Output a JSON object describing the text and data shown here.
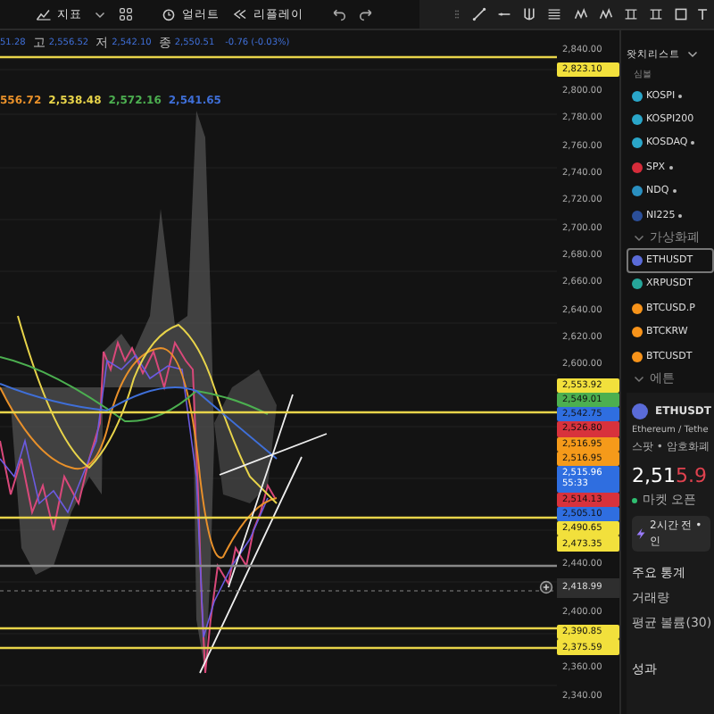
{
  "toolbar": {
    "items": [
      {
        "kind": "indicators",
        "label": "지표"
      },
      {
        "kind": "caret"
      },
      {
        "kind": "layout"
      },
      {
        "kind": "alert",
        "label": "얼러트"
      },
      {
        "kind": "replay",
        "label": "리플레이"
      },
      {
        "kind": "undo"
      },
      {
        "kind": "redo"
      }
    ]
  },
  "drawing_tools": [
    {
      "kind": "handle"
    },
    {
      "kind": "trend"
    },
    {
      "kind": "hray"
    },
    {
      "kind": "fork"
    },
    {
      "kind": "fib"
    },
    {
      "kind": "wave"
    },
    {
      "kind": "wave2"
    },
    {
      "kind": "range"
    },
    {
      "kind": "range2"
    },
    {
      "kind": "rect"
    },
    {
      "kind": "text",
      "label": "T"
    }
  ],
  "legend": {
    "first": "51.28",
    "ohlc": [
      {
        "label": "고",
        "value": "2,556.52"
      },
      {
        "label": "저",
        "value": "2,542.10"
      },
      {
        "label": "종",
        "value": "2,550.51"
      }
    ],
    "change": "-0.76 (-0.03%)",
    "ma": [
      {
        "value": "556.72",
        "color": "#e8902a"
      },
      {
        "value": "2,538.48",
        "color": "#e8d44a"
      },
      {
        "value": "2,572.16",
        "color": "#4caf50"
      },
      {
        "value": "2,541.65",
        "color": "#3f6fd8"
      }
    ]
  },
  "price_axis": [
    {
      "kind": "tick",
      "text": "2,840.00"
    },
    {
      "kind": "tag",
      "text": "2,823.10",
      "color": "#f2e03c"
    },
    {
      "kind": "tick",
      "text": "2,800.00"
    },
    {
      "kind": "tick",
      "text": "2,780.00"
    },
    {
      "kind": "tick",
      "text": "2,760.00"
    },
    {
      "kind": "tick",
      "text": "2,740.00"
    },
    {
      "kind": "tick",
      "text": "2,720.00"
    },
    {
      "kind": "tick",
      "text": "2,700.00"
    },
    {
      "kind": "tick",
      "text": "2,680.00"
    },
    {
      "kind": "tick",
      "text": "2,660.00"
    },
    {
      "kind": "tick",
      "text": "2,640.00"
    },
    {
      "kind": "tick",
      "text": "2,620.00"
    },
    {
      "kind": "tick",
      "text": "2,600.00"
    },
    {
      "kind": "tag",
      "text": "2,553.92",
      "color": "#f2e03c"
    },
    {
      "kind": "tag",
      "text": "2,549.01",
      "color": "#4caf50"
    },
    {
      "kind": "tag",
      "text": "2,542.75",
      "color": "#2f6ee0"
    },
    {
      "kind": "tag",
      "text": "2,526.80",
      "color": "#d8323c"
    },
    {
      "kind": "tag",
      "text": "2,516.95",
      "color": "#f59a1a"
    },
    {
      "kind": "tag",
      "text": "2,516.95",
      "color": "#f59a1a"
    },
    {
      "kind": "tag",
      "text": "2,515.96",
      "sub": "55:33",
      "color": "#2f6ee0"
    },
    {
      "kind": "tag",
      "text": "2,514.13",
      "color": "#d8323c"
    },
    {
      "kind": "tag",
      "text": "2,505.10",
      "color": "#2f6ee0"
    },
    {
      "kind": "tag",
      "text": "2,490.65",
      "color": "#f2e03c"
    },
    {
      "kind": "tag",
      "text": "2,473.35",
      "color": "#f2e03c"
    },
    {
      "kind": "tick",
      "text": "2,440.00"
    },
    {
      "kind": "cursor",
      "text": "2,418.99"
    },
    {
      "kind": "tick",
      "text": "2,400.00"
    },
    {
      "kind": "tag",
      "text": "2,390.85",
      "color": "#f2e03c"
    },
    {
      "kind": "tag",
      "text": "2,375.59",
      "color": "#f2e03c"
    },
    {
      "kind": "tick",
      "text": "2,360.00"
    },
    {
      "kind": "tick",
      "text": "2,340.00"
    }
  ],
  "watchlist": {
    "title": "왓치리스트",
    "column": "심볼",
    "rows": [
      {
        "kind": "symbol",
        "name": "KOSPI",
        "color": "#2aa6c9",
        "dot": true,
        "selected": false
      },
      {
        "kind": "symbol",
        "name": "KOSPI200",
        "color": "#2aa6c9",
        "dot": false,
        "selected": false
      },
      {
        "kind": "symbol",
        "name": "KOSDAQ",
        "color": "#2aa6c9",
        "dot": true,
        "selected": false
      },
      {
        "kind": "symbol",
        "name": "SPX",
        "color": "#d62c3a",
        "dot": true,
        "selected": false
      },
      {
        "kind": "symbol",
        "name": "NDQ",
        "color": "#2a8fc0",
        "dot": true,
        "selected": false
      },
      {
        "kind": "symbol",
        "name": "NI225",
        "color": "#2b4f9a",
        "dot": true,
        "selected": false
      },
      {
        "kind": "section",
        "name": "가상화폐"
      },
      {
        "kind": "symbol",
        "name": "ETHUSDT",
        "color": "#5a6bd8",
        "dot": false,
        "selected": true
      },
      {
        "kind": "symbol",
        "name": "XRPUSDT",
        "color": "#26a69a",
        "dot": false,
        "selected": false
      },
      {
        "kind": "symbol",
        "name": "BTCUSD.P",
        "color": "#f7931a",
        "dot": false,
        "selected": false
      },
      {
        "kind": "symbol",
        "name": "BTCKRW",
        "color": "#f7931a",
        "dot": false,
        "selected": false
      },
      {
        "kind": "symbol",
        "name": "BTCUSDT",
        "color": "#f7931a",
        "dot": false,
        "selected": false
      },
      {
        "kind": "section",
        "name": "에튼"
      }
    ]
  },
  "details": {
    "symbol": "ETHUSDT",
    "description": "Ethereum / Tethe",
    "category": "스팟 • 암호화폐",
    "price_main": "2,51",
    "price_tail": "5.9",
    "market": "마켓 오픈",
    "news": "2시간 전 • 인",
    "stats_title": "주요 통계",
    "stats": [
      "거래량",
      "평균 볼륨(30)"
    ],
    "performance": "성과"
  }
}
